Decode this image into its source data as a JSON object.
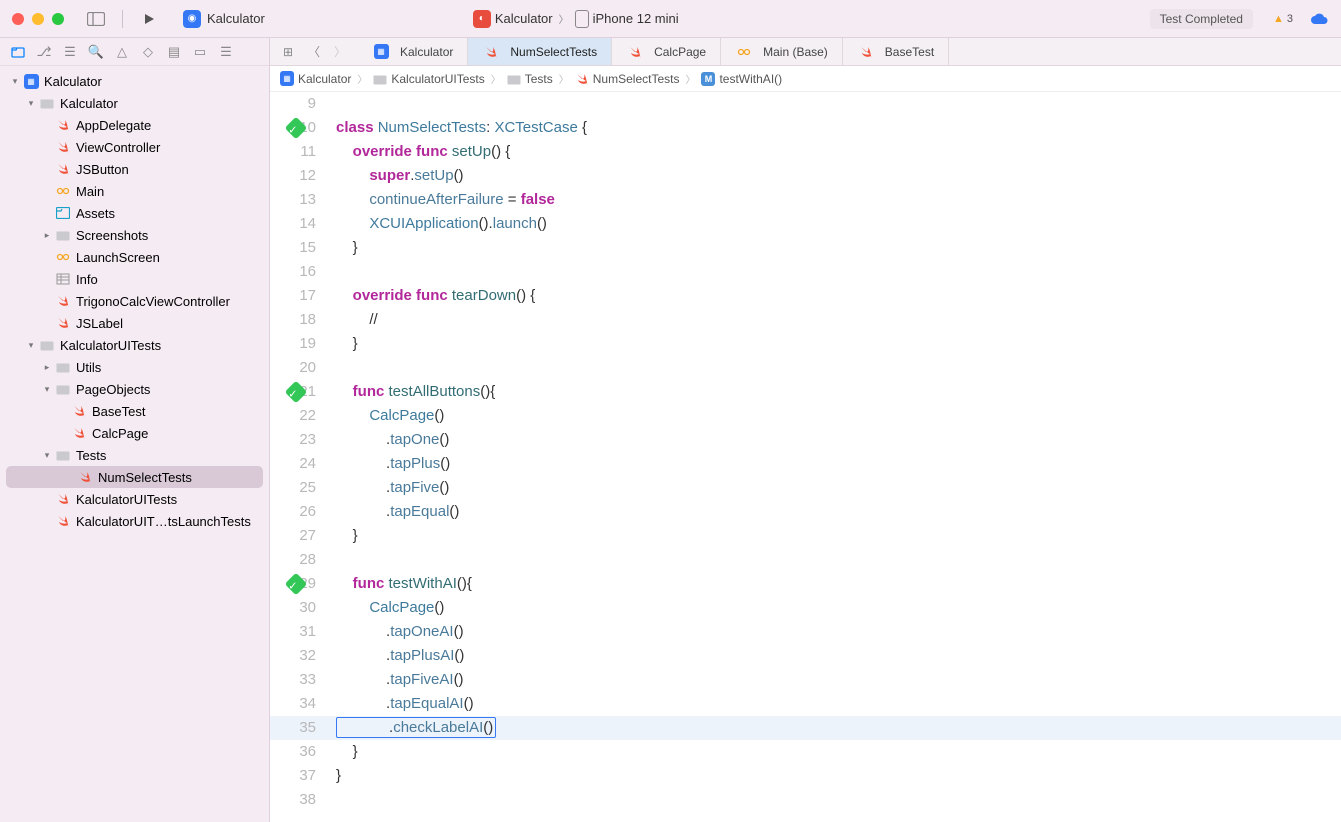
{
  "titlebar": {
    "app_name": "Kalculator",
    "scheme": "Kalculator",
    "device": "iPhone 12 mini",
    "status": "Test Completed",
    "warnings": "3"
  },
  "tabs": [
    {
      "label": "Kalculator",
      "icon": "proj"
    },
    {
      "label": "NumSelectTests",
      "icon": "swift",
      "active": true
    },
    {
      "label": "CalcPage",
      "icon": "swift"
    },
    {
      "label": "Main (Base)",
      "icon": "ib"
    },
    {
      "label": "BaseTest",
      "icon": "swift"
    }
  ],
  "breadcrumb": [
    {
      "label": "Kalculator",
      "icon": "proj"
    },
    {
      "label": "KalculatorUITests",
      "icon": "folder"
    },
    {
      "label": "Tests",
      "icon": "folder"
    },
    {
      "label": "NumSelectTests",
      "icon": "swift"
    },
    {
      "label": "testWithAI()",
      "icon": "method"
    }
  ],
  "tree": {
    "root": "Kalculator",
    "app_group": "Kalculator",
    "files_app": [
      "AppDelegate",
      "ViewController",
      "JSButton",
      "Main",
      "Assets",
      "Screenshots",
      "LaunchScreen",
      "Info",
      "TrigonoCalcViewController",
      "JSLabel"
    ],
    "uitests_group": "KalculatorUITests",
    "utils": "Utils",
    "pageobjects": "PageObjects",
    "po_files": [
      "BaseTest",
      "CalcPage"
    ],
    "tests_group": "Tests",
    "tests_file": "NumSelectTests",
    "other_tests": [
      "KalculatorUITests",
      "KalculatorUIT…tsLaunchTests"
    ]
  },
  "code": {
    "lines": [
      {
        "n": 9,
        "t": ""
      },
      {
        "n": 10,
        "d": true,
        "seg": [
          [
            "kw",
            "class "
          ],
          [
            "type",
            "NumSelectTests"
          ],
          [
            "",
            ": "
          ],
          [
            "type",
            "XCTestCase"
          ],
          [
            "",
            " {"
          ]
        ]
      },
      {
        "n": 11,
        "seg": [
          [
            "",
            "    "
          ],
          [
            "kw",
            "override"
          ],
          [
            "",
            " "
          ],
          [
            "kw",
            "func"
          ],
          [
            "",
            " "
          ],
          [
            "func",
            "setUp"
          ],
          [
            "",
            "() {"
          ]
        ]
      },
      {
        "n": 12,
        "seg": [
          [
            "",
            "        "
          ],
          [
            "self",
            "super"
          ],
          [
            "",
            "."
          ],
          [
            "call",
            "setUp"
          ],
          [
            "",
            "()"
          ]
        ]
      },
      {
        "n": 13,
        "seg": [
          [
            "",
            "        "
          ],
          [
            "call",
            "continueAfterFailure"
          ],
          [
            "",
            " = "
          ],
          [
            "literal",
            "false"
          ]
        ]
      },
      {
        "n": 14,
        "seg": [
          [
            "",
            "        "
          ],
          [
            "type",
            "XCUIApplication"
          ],
          [
            "",
            "()."
          ],
          [
            "call",
            "launch"
          ],
          [
            "",
            "()"
          ]
        ]
      },
      {
        "n": 15,
        "seg": [
          [
            "",
            "    }"
          ]
        ]
      },
      {
        "n": 16,
        "seg": [
          [
            "",
            ""
          ]
        ]
      },
      {
        "n": 17,
        "seg": [
          [
            "",
            "    "
          ],
          [
            "kw",
            "override"
          ],
          [
            "",
            " "
          ],
          [
            "kw",
            "func"
          ],
          [
            "",
            " "
          ],
          [
            "func",
            "tearDown"
          ],
          [
            "",
            "() {"
          ]
        ]
      },
      {
        "n": 18,
        "seg": [
          [
            "",
            "        //"
          ]
        ]
      },
      {
        "n": 19,
        "seg": [
          [
            "",
            "    }"
          ]
        ]
      },
      {
        "n": 20,
        "seg": [
          [
            "",
            ""
          ]
        ]
      },
      {
        "n": 21,
        "d": true,
        "seg": [
          [
            "",
            "    "
          ],
          [
            "kw",
            "func"
          ],
          [
            "",
            " "
          ],
          [
            "func",
            "testAllButtons"
          ],
          [
            "",
            "(){"
          ]
        ]
      },
      {
        "n": 22,
        "seg": [
          [
            "",
            "        "
          ],
          [
            "type",
            "CalcPage"
          ],
          [
            "",
            "()"
          ]
        ]
      },
      {
        "n": 23,
        "seg": [
          [
            "",
            "            ."
          ],
          [
            "call",
            "tapOne"
          ],
          [
            "",
            "()"
          ]
        ]
      },
      {
        "n": 24,
        "seg": [
          [
            "",
            "            ."
          ],
          [
            "call",
            "tapPlus"
          ],
          [
            "",
            "()"
          ]
        ]
      },
      {
        "n": 25,
        "seg": [
          [
            "",
            "            ."
          ],
          [
            "call",
            "tapFive"
          ],
          [
            "",
            "()"
          ]
        ]
      },
      {
        "n": 26,
        "seg": [
          [
            "",
            "            ."
          ],
          [
            "call",
            "tapEqual"
          ],
          [
            "",
            "()"
          ]
        ]
      },
      {
        "n": 27,
        "seg": [
          [
            "",
            "    }"
          ]
        ]
      },
      {
        "n": 28,
        "seg": [
          [
            "",
            ""
          ]
        ]
      },
      {
        "n": 29,
        "d": true,
        "seg": [
          [
            "",
            "    "
          ],
          [
            "kw",
            "func"
          ],
          [
            "",
            " "
          ],
          [
            "func",
            "testWithAI"
          ],
          [
            "",
            "(){"
          ]
        ]
      },
      {
        "n": 30,
        "seg": [
          [
            "",
            "        "
          ],
          [
            "type",
            "CalcPage"
          ],
          [
            "",
            "()"
          ]
        ]
      },
      {
        "n": 31,
        "seg": [
          [
            "",
            "            ."
          ],
          [
            "call",
            "tapOneAI"
          ],
          [
            "",
            "()"
          ]
        ]
      },
      {
        "n": 32,
        "seg": [
          [
            "",
            "            ."
          ],
          [
            "call",
            "tapPlusAI"
          ],
          [
            "",
            "()"
          ]
        ]
      },
      {
        "n": 33,
        "seg": [
          [
            "",
            "            ."
          ],
          [
            "call",
            "tapFiveAI"
          ],
          [
            "",
            "()"
          ]
        ]
      },
      {
        "n": 34,
        "seg": [
          [
            "",
            "            ."
          ],
          [
            "call",
            "tapEqualAI"
          ],
          [
            "",
            "()"
          ]
        ]
      },
      {
        "n": 35,
        "cur": true,
        "box": true,
        "seg": [
          [
            "",
            "            ."
          ],
          [
            "call",
            "checkLabelAI"
          ],
          [
            "",
            "()"
          ]
        ]
      },
      {
        "n": 36,
        "seg": [
          [
            "",
            "    }"
          ]
        ]
      },
      {
        "n": 37,
        "seg": [
          [
            "",
            "}"
          ]
        ]
      },
      {
        "n": 38,
        "seg": [
          [
            "",
            ""
          ]
        ]
      }
    ]
  }
}
